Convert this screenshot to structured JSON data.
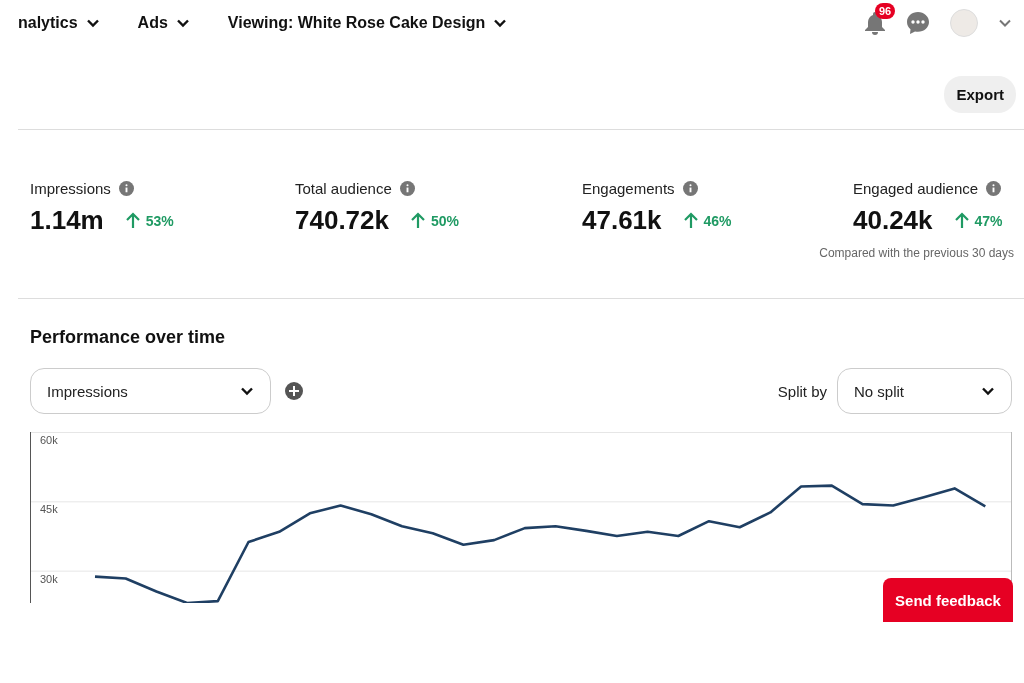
{
  "nav": {
    "items": [
      {
        "label": "nalytics"
      },
      {
        "label": "Ads"
      },
      {
        "label": "Viewing: White Rose Cake Design"
      }
    ],
    "notifications_badge": "96"
  },
  "export_button": "Export",
  "metrics": [
    {
      "label": "Impressions",
      "value": "1.14m",
      "change": "53%"
    },
    {
      "label": "Total audience",
      "value": "740.72k",
      "change": "50%"
    },
    {
      "label": "Engagements",
      "value": "47.61k",
      "change": "46%"
    },
    {
      "label": "Engaged audience",
      "value": "40.24k",
      "change": "47%"
    }
  ],
  "comparison_note": "Compared with the previous 30 days",
  "performance": {
    "title": "Performance over time",
    "metric_select": "Impressions",
    "split_label": "Split by",
    "split_select": "No split",
    "chart_data": {
      "type": "line",
      "ylim": [
        23,
        60
      ],
      "yticks": [
        {
          "value": 30,
          "label": "30k"
        },
        {
          "value": 45,
          "label": "45k"
        },
        {
          "value": 60,
          "label": "60k"
        }
      ],
      "series": [
        {
          "color": "#1f3f63",
          "values": [
            28.7,
            28.3,
            25.5,
            23,
            23.4,
            36.2,
            38.4,
            42.4,
            44.1,
            42.2,
            39.6,
            38.1,
            35.6,
            36.6,
            39.2,
            39.6,
            38.6,
            37.5,
            38.4,
            37.5,
            40.7,
            39.4,
            42.6,
            48.2,
            48.4,
            44.4,
            44.1,
            45.9,
            47.8,
            43.9
          ]
        }
      ]
    }
  },
  "feedback_button": "Send feedback"
}
